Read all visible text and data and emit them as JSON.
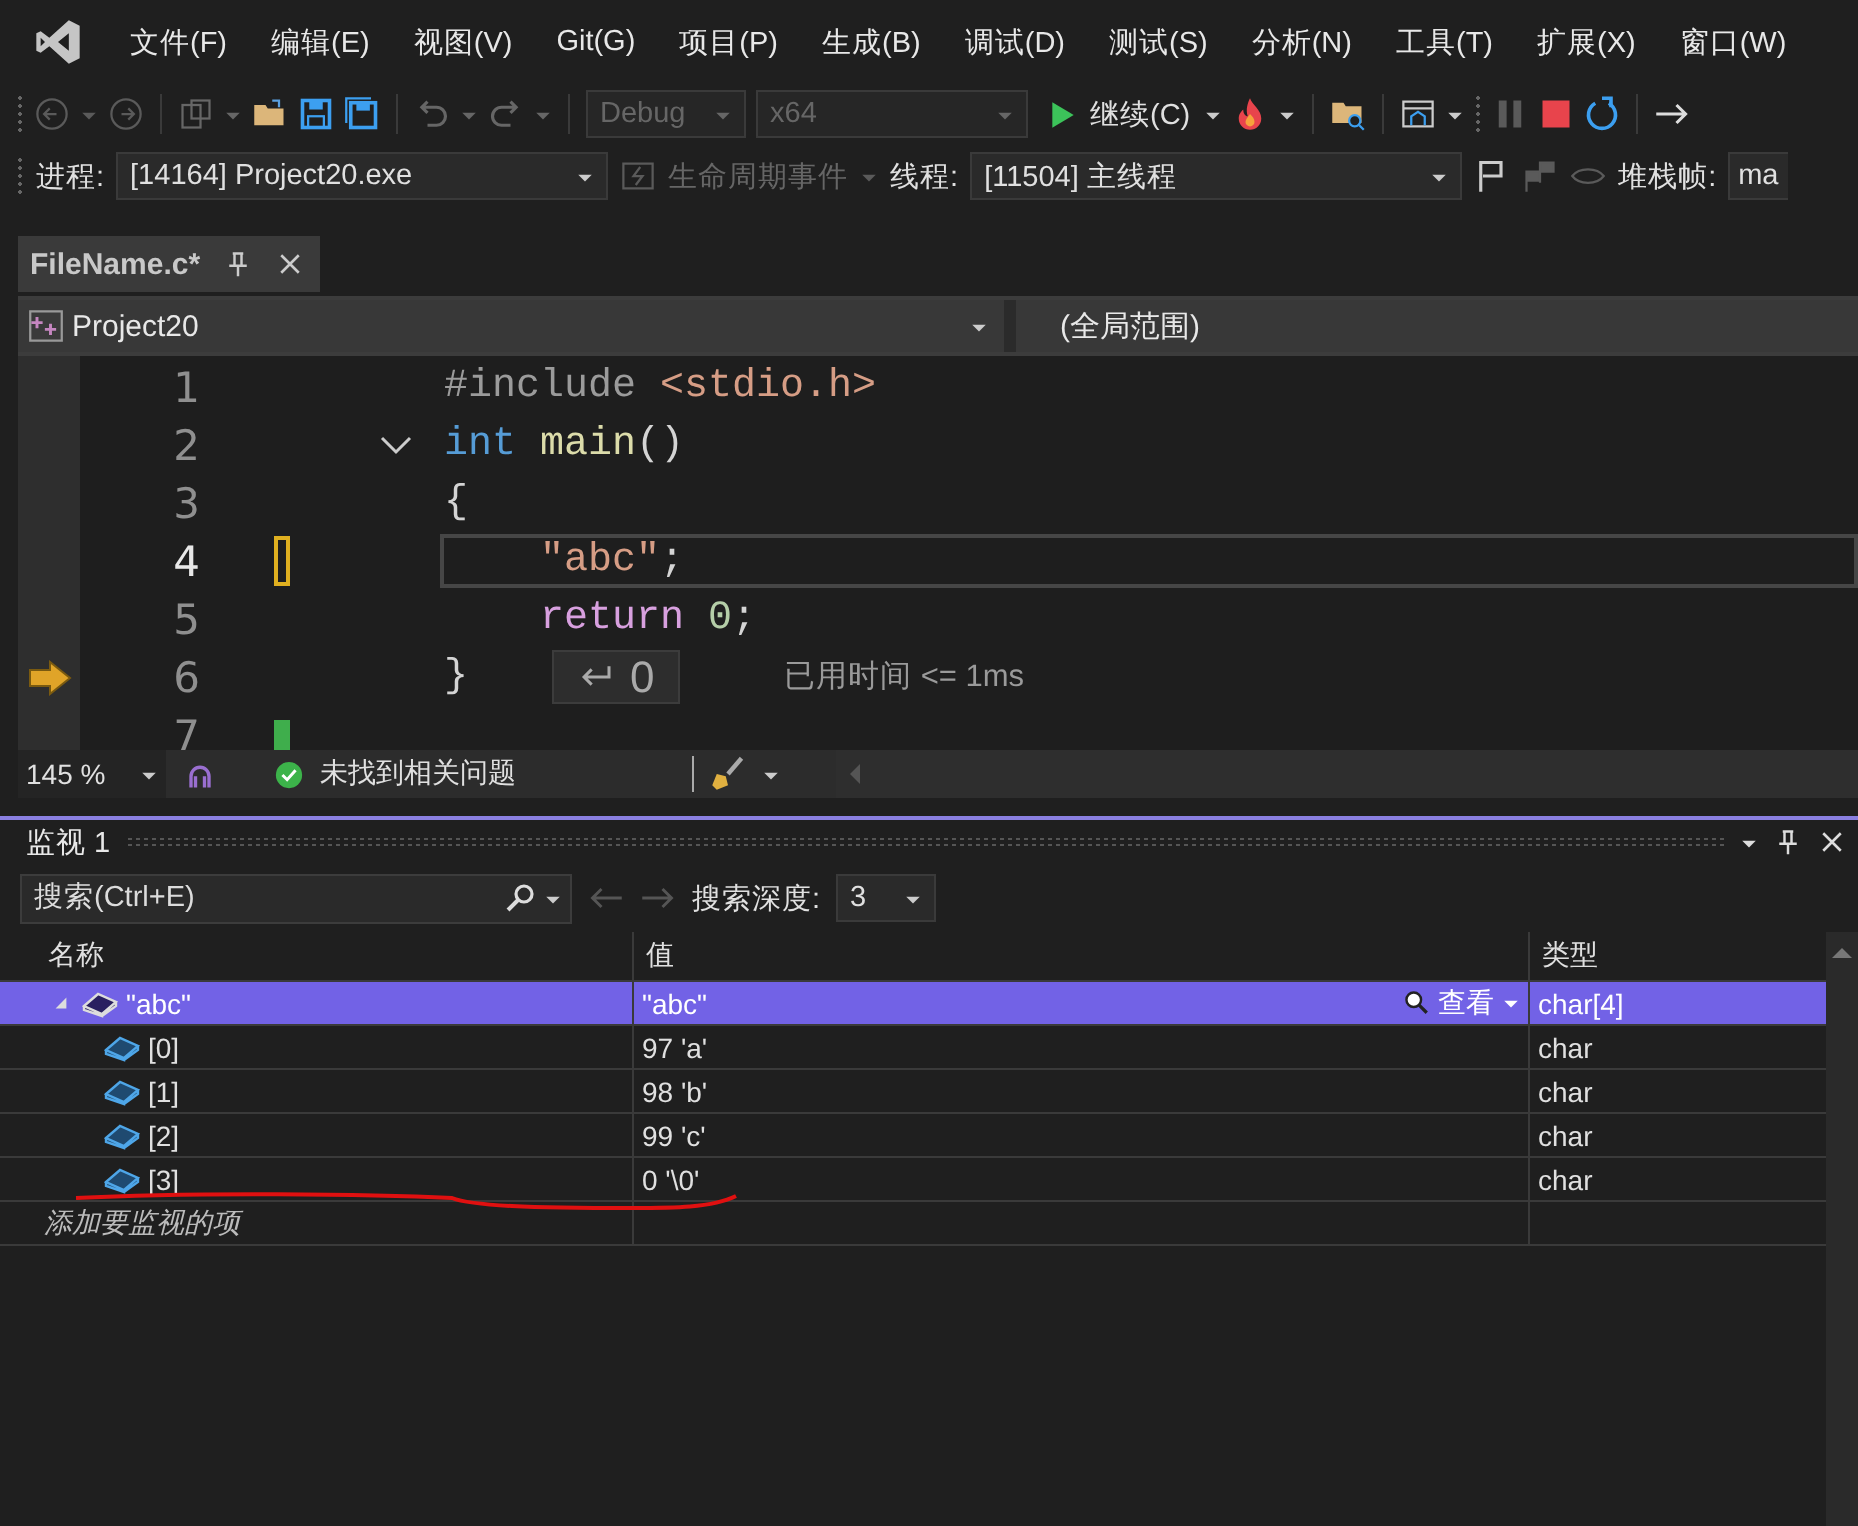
{
  "menu": [
    "文件(F)",
    "编辑(E)",
    "视图(V)",
    "Git(G)",
    "项目(P)",
    "生成(B)",
    "调试(D)",
    "测试(S)",
    "分析(N)",
    "工具(T)",
    "扩展(X)",
    "窗口(W)"
  ],
  "toolbar": {
    "configuration": "Debug",
    "platform": "x64",
    "continue": "继续(C)"
  },
  "debug_location": {
    "process_label": "进程:",
    "process": "[14164] Project20.exe",
    "lifecycle": "生命周期事件",
    "thread_label": "线程:",
    "thread": "[11504] 主线程",
    "stack_label": "堆栈帧:",
    "stack": "ma"
  },
  "tabs": [
    {
      "title": "FileName.c*",
      "selected": true
    }
  ],
  "navigation": {
    "project": "Project20",
    "scope": "(全局范围)"
  },
  "code_lines": [
    {
      "number": "1",
      "current": false,
      "fold": false,
      "unsaved_change": false,
      "saved_change": false,
      "instruction_pointer": false,
      "tokens": [
        {
          "kind": "preproc",
          "text": "#include "
        },
        {
          "kind": "string",
          "text": "<stdio.h>"
        }
      ]
    },
    {
      "number": "2",
      "current": false,
      "fold": true,
      "unsaved_change": false,
      "saved_change": false,
      "instruction_pointer": false,
      "tokens": [
        {
          "kind": "keyword",
          "text": "int "
        },
        {
          "kind": "function",
          "text": "main"
        },
        {
          "kind": "punct",
          "text": "()"
        }
      ]
    },
    {
      "number": "3",
      "current": false,
      "fold": false,
      "unsaved_change": false,
      "saved_change": false,
      "instruction_pointer": false,
      "tokens": [
        {
          "kind": "punct",
          "text": "{"
        }
      ]
    },
    {
      "number": "4",
      "current": true,
      "fold": false,
      "unsaved_change": true,
      "saved_change": false,
      "instruction_pointer": false,
      "tokens": [
        {
          "kind": "string",
          "text": "    \"abc\""
        },
        {
          "kind": "punct",
          "text": ";"
        }
      ]
    },
    {
      "number": "5",
      "current": false,
      "fold": false,
      "unsaved_change": false,
      "saved_change": false,
      "instruction_pointer": false,
      "tokens": [
        {
          "kind": "control",
          "text": "    return "
        },
        {
          "kind": "number",
          "text": "0"
        },
        {
          "kind": "punct",
          "text": ";"
        }
      ]
    },
    {
      "number": "6",
      "current": false,
      "fold": false,
      "unsaved_change": false,
      "saved_change": false,
      "instruction_pointer": true,
      "tokens": [
        {
          "kind": "punct",
          "text": "}"
        }
      ],
      "return_value": "0",
      "elapsed": "已用时间 <= 1ms"
    },
    {
      "number": "7",
      "current": false,
      "fold": false,
      "unsaved_change": false,
      "saved_change": true,
      "instruction_pointer": false
    }
  ],
  "editor_status": {
    "zoom": "145 %",
    "issues": "未找到相关问题"
  },
  "watch": {
    "title": "监视 1",
    "search_placeholder": "搜索(Ctrl+E)",
    "depth_label": "搜索深度:",
    "depth": "3",
    "view_button": "查看",
    "columns": [
      "名称",
      "值",
      "类型"
    ],
    "rows": [
      {
        "name": "\"abc\"",
        "value": "\"abc\"",
        "type": "char[4]",
        "expanded": true,
        "selected": true,
        "children": [
          {
            "name": "[0]",
            "value": "97 'a'",
            "type": "char",
            "selected": false
          },
          {
            "name": "[1]",
            "value": "98 'b'",
            "type": "char",
            "selected": false
          },
          {
            "name": "[2]",
            "value": "99 'c'",
            "type": "char",
            "selected": false
          },
          {
            "name": "[3]",
            "value": "0 '\\0'",
            "type": "char",
            "selected": false
          }
        ]
      }
    ],
    "add_placeholder": "添加要监视的项"
  }
}
